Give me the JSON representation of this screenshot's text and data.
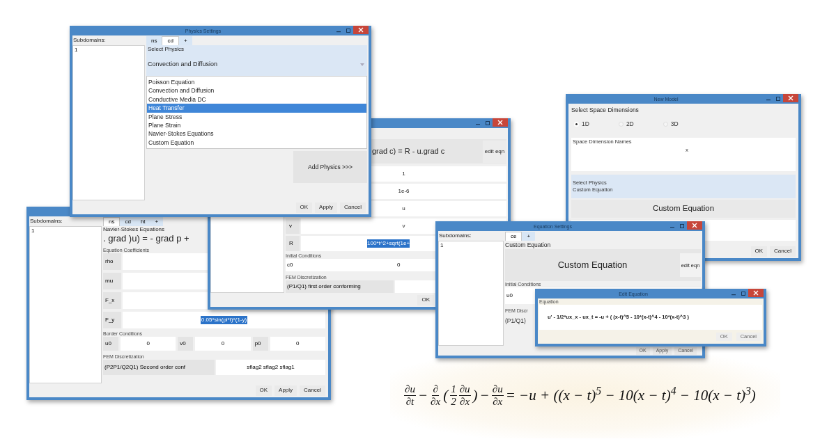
{
  "physics_window": {
    "title": "Physics Settings",
    "subdomains_label": "Subdomains:",
    "subdomains": [
      "1"
    ],
    "tabs": [
      {
        "label": "ns",
        "selected": false
      },
      {
        "label": "cd",
        "selected": true
      },
      {
        "label": "+",
        "selected": false
      }
    ],
    "select_label": "Select Physics",
    "combo_value": "Convection and Diffusion",
    "options": [
      {
        "label": "Poisson Equation",
        "selected": false
      },
      {
        "label": "Convection and Diffusion",
        "selected": false
      },
      {
        "label": "Conductive Media DC",
        "selected": false
      },
      {
        "label": "Heat Transfer",
        "selected": true
      },
      {
        "label": "Plane Stress",
        "selected": false
      },
      {
        "label": "Plane Strain",
        "selected": false
      },
      {
        "label": "Navier-Stokes Equations",
        "selected": false
      },
      {
        "label": "Custom Equation",
        "selected": false
      }
    ],
    "add_button": "Add Physics >>>",
    "buttons": [
      "OK",
      "Apply",
      "Cancel"
    ]
  },
  "coefficients_window": {
    "equation": "grad c) = R - u.grad c",
    "edit_button": "edit eqn",
    "rows": [
      {
        "value": "1",
        "selected": false
      },
      {
        "value": "1e-6",
        "selected": false
      },
      {
        "value": "u",
        "selected": false
      },
      {
        "label": "v",
        "value": "v",
        "selected": false
      },
      {
        "label": "R",
        "value": "100*t^2+sqrt(1e+",
        "selected": true
      }
    ],
    "initial_label": "Initial Conditions",
    "initial": {
      "label": "c0",
      "value": "0"
    },
    "fem_label": "FEM Discretization",
    "fem_value": "(P1/Q1) first order conforming",
    "buttons": [
      "OK"
    ]
  },
  "navier_stokes_window": {
    "subdomains_label": "Subdomains:",
    "subdomains": [
      "1"
    ],
    "tabs": [
      {
        "label": "ns",
        "selected": true
      },
      {
        "label": "cd",
        "selected": false
      },
      {
        "label": "ht",
        "selected": false
      },
      {
        "label": "+",
        "selected": false
      }
    ],
    "physics_label": "Navier-Stokes Equations",
    "equation": ". grad )u) = - grad p +",
    "coefficients_label": "Equation Coefficients",
    "rows": [
      {
        "label": "rho"
      },
      {
        "label": "mu"
      },
      {
        "label": "F_x"
      },
      {
        "label": "F_y",
        "value": "0.05*sin(pi*t)*(1-y)",
        "selected": true
      }
    ],
    "border_label": "Border Conditions",
    "border": [
      {
        "label": "u0",
        "value": "0"
      },
      {
        "label": "v0",
        "value": "0"
      },
      {
        "label": "p0",
        "value": "0"
      }
    ],
    "fem_label": "FEM Discretization",
    "fem_value": "(P2P1/Q2Q1) Second order conf",
    "fem_flags": "sflag2 sflag2 sflag1",
    "buttons": [
      "OK",
      "Apply",
      "Cancel"
    ]
  },
  "new_model_window": {
    "title": "New Model",
    "dims_label": "Select Space Dimensions",
    "dims": [
      {
        "label": "1D",
        "selected": true
      },
      {
        "label": "2D",
        "selected": false
      },
      {
        "label": "3D",
        "selected": false
      }
    ],
    "names_label": "Space Dimension Names",
    "names_value": "x",
    "physics_label": "Select Physics",
    "physics_value": "Custom Equation",
    "equation_button": "Custom Equation",
    "buttons": [
      "OK",
      "Cancel"
    ]
  },
  "equation_settings_window": {
    "title": "Equation Settings",
    "subdomains_label": "Subdomains:",
    "subdomains": [
      "1"
    ],
    "tabs": [
      {
        "label": "ce",
        "selected": true
      },
      {
        "label": "+",
        "selected": false
      }
    ],
    "physics_label": "Custom Equation",
    "equation_button": "Custom Equation",
    "edit_button": "edit eqn",
    "initial_label": "Initial Conditions",
    "initial_var": "u0",
    "fem_label": "FEM Discr",
    "fem_value": "(P1/Q1)",
    "buttons": [
      "OK",
      "Apply",
      "Cancel"
    ]
  },
  "edit_equation_window": {
    "title": "Edit Equation",
    "field_label": "Equation",
    "value": "u' - 1/2*ux_x - ux_t = -u + ( (x-t)^5 - 10*(x-t)^4 - 10*(x-t)^3 )",
    "buttons": [
      "OK",
      "Cancel"
    ]
  },
  "formula": [
    {
      "kind": "frac",
      "num": "∂u",
      "den": "∂t"
    },
    {
      "kind": "text",
      "text": "−"
    },
    {
      "kind": "frac",
      "num": "∂",
      "den": "∂x"
    },
    {
      "kind": "text",
      "text": "("
    },
    {
      "kind": "frac",
      "num": "1",
      "den": "2"
    },
    {
      "kind": "frac",
      "num": "∂u",
      "den": "∂x"
    },
    {
      "kind": "text",
      "text": ")"
    },
    {
      "kind": "text",
      "text": "−"
    },
    {
      "kind": "frac",
      "num": "∂u",
      "den": "∂x"
    },
    {
      "kind": "text",
      "text": "= −u + ((x − t)$^{5}$ − 10(x − t)$^{4}$ − 10(x − t)$^{3}$)"
    }
  ]
}
